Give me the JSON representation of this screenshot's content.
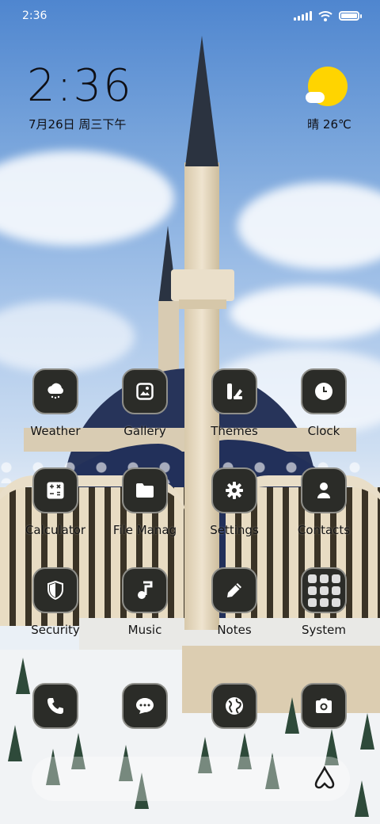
{
  "status_bar": {
    "time": "2:36"
  },
  "clock_widget": {
    "time": "2:36",
    "date": "7月26日 周三下午"
  },
  "weather_widget": {
    "condition_icon": "sunny-partly-cloudy-icon",
    "text": "晴 26℃",
    "sun_color": "#ffd400"
  },
  "apps": [
    {
      "label": "Weather",
      "icon": "weather-cloud-icon"
    },
    {
      "label": "Gallery",
      "icon": "gallery-icon"
    },
    {
      "label": "Themes",
      "icon": "themes-icon"
    },
    {
      "label": "Clock",
      "icon": "clock-icon"
    },
    {
      "label": "Calculator",
      "icon": "calculator-icon"
    },
    {
      "label": "File Manag",
      "icon": "folder-icon"
    },
    {
      "label": "Settings",
      "icon": "gear-icon"
    },
    {
      "label": "Contacts",
      "icon": "contact-icon"
    },
    {
      "label": "Security",
      "icon": "shield-icon"
    },
    {
      "label": "Music",
      "icon": "music-note-icon"
    },
    {
      "label": "Notes",
      "icon": "pencil-icon"
    },
    {
      "label": "System",
      "icon": "folder-grid-icon"
    }
  ],
  "dock": [
    {
      "icon": "phone-icon"
    },
    {
      "icon": "messages-icon"
    },
    {
      "icon": "browser-globe-icon"
    },
    {
      "icon": "camera-icon"
    }
  ],
  "colors": {
    "icon_bg": "#2b2c28",
    "label_text": "#141414"
  }
}
